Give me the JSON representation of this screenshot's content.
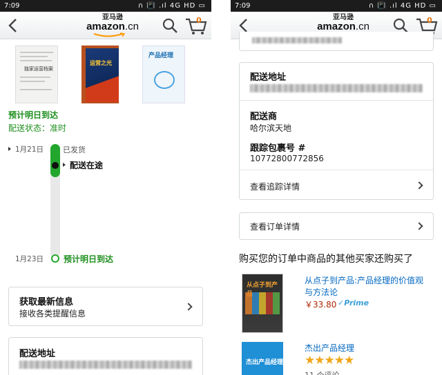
{
  "status_bar": {
    "time": "7:09",
    "icons": "∩ 📳 .ıl 4G HD ▭"
  },
  "nav": {
    "logo_cn": "亚马逊",
    "logo_en": "amazon",
    "logo_tld": ".cn",
    "cart_count": "0"
  },
  "left": {
    "thumb1_title": "独家运营档案",
    "thumb2_title": "运营之光",
    "thumb3_title": "产品经理",
    "delivery_eta": "预计明日到达",
    "delivery_status": "配送状态：准时",
    "timeline": {
      "start_date": "1月21日",
      "start_label": "已发货",
      "current_label": "配送在途",
      "end_date": "1月23日",
      "end_label": "预计明日到达"
    },
    "updates_card": {
      "title": "获取最新信息",
      "subtitle": "接收各类提醒信息"
    },
    "address_title": "配送地址"
  },
  "right": {
    "address_title": "配送地址",
    "carrier_title": "配送商",
    "carrier_name": "哈尔滨天地",
    "tracking_title": "跟踪包裹号 #",
    "tracking_number": "10772800772856",
    "view_tracking": "查看追踪详情",
    "view_order": "查看订单详情",
    "also_bought_title": "购买您的订单中商品的其他买家还购买了",
    "products": [
      {
        "img_title": "从点子到产品",
        "title_line1": "从点子到产品:产品经理的价值观",
        "title_line2": "与方法论",
        "price": "￥33.80",
        "prime": "✓Prime"
      },
      {
        "img_title": "杰出产品经理",
        "title_line1": "杰出产品经理",
        "stars": "★★★★★",
        "rating_value": 4.5,
        "reviews": "11 个评论"
      }
    ]
  }
}
